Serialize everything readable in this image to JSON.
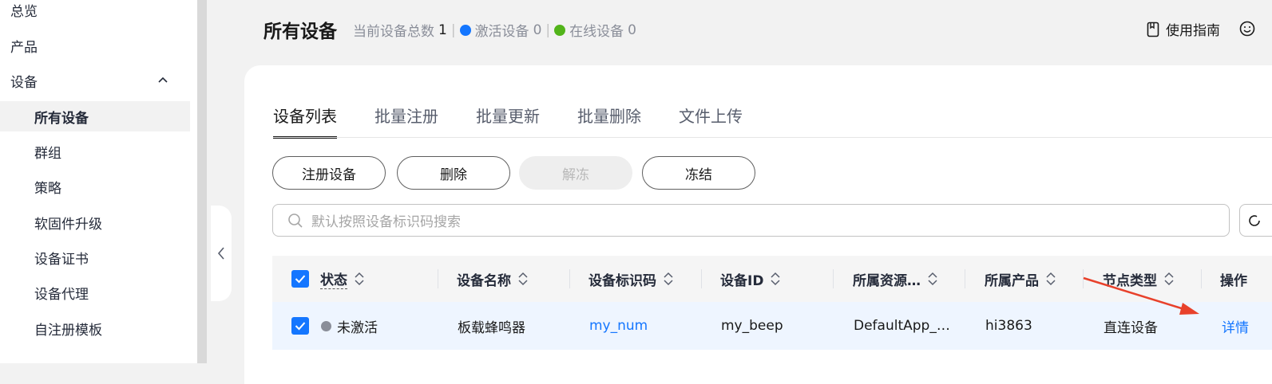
{
  "sidebar": {
    "items": [
      {
        "label": "总览"
      },
      {
        "label": "产品"
      },
      {
        "label": "设备"
      },
      {
        "label": "所有设备"
      },
      {
        "label": "群组"
      },
      {
        "label": "策略"
      },
      {
        "label": "软固件升级"
      },
      {
        "label": "设备证书"
      },
      {
        "label": "设备代理"
      },
      {
        "label": "自注册模板"
      }
    ]
  },
  "header": {
    "title": "所有设备",
    "total_label": "当前设备总数",
    "total_value": "1",
    "active_label": "激活设备",
    "active_value": "0",
    "online_label": "在线设备",
    "online_value": "0",
    "guide_label": "使用指南"
  },
  "tabs": [
    {
      "label": "设备列表"
    },
    {
      "label": "批量注册"
    },
    {
      "label": "批量更新"
    },
    {
      "label": "批量删除"
    },
    {
      "label": "文件上传"
    }
  ],
  "actions": {
    "register": "注册设备",
    "delete": "删除",
    "unfreeze": "解冻",
    "freeze": "冻结"
  },
  "search": {
    "placeholder": "默认按照设备标识码搜索"
  },
  "table": {
    "columns": [
      "状态",
      "设备名称",
      "设备标识码",
      "设备ID",
      "所属资源…",
      "所属产品",
      "节点类型",
      "操作"
    ],
    "rows": [
      {
        "status": "未激活",
        "name": "板载蜂鸣器",
        "node_code": "my_num",
        "device_id": "my_beep",
        "resource": "DefaultApp_…",
        "product": "hi3863",
        "node_type": "直连设备",
        "action": "详情"
      }
    ]
  },
  "colors": {
    "accent": "#1476ff",
    "active_dot": "#1476ff",
    "online_dot": "#52b41a",
    "arrow": "#e8412b"
  }
}
